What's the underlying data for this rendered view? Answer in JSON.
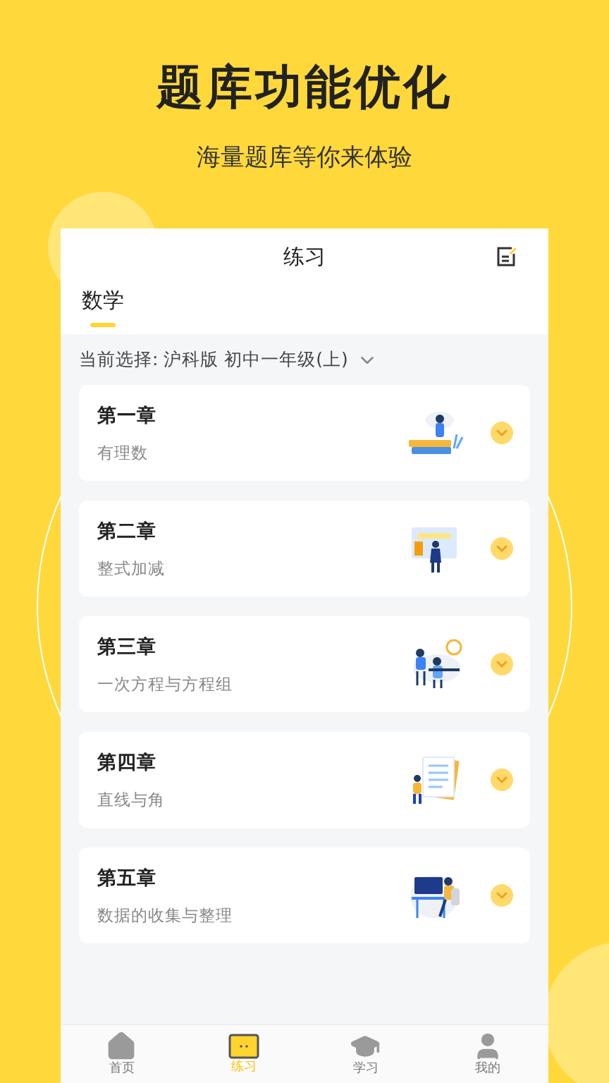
{
  "headline": "题库功能优化",
  "subtitle": "海量题库等你来体验",
  "screen": {
    "title": "练习",
    "subject_tabs": [
      {
        "label": "数学",
        "selected": true
      }
    ],
    "current_selection": "当前选择: 沪科版 初中一年级(上)",
    "chapters": [
      {
        "title": "第一章",
        "topic": "有理数"
      },
      {
        "title": "第二章",
        "topic": "整式加减"
      },
      {
        "title": "第三章",
        "topic": "一次方程与方程组"
      },
      {
        "title": "第四章",
        "topic": "直线与角"
      },
      {
        "title": "第五章",
        "topic": "数据的收集与整理"
      }
    ],
    "nav": [
      {
        "label": "首页",
        "selected": false
      },
      {
        "label": "练习",
        "selected": true
      },
      {
        "label": "学习",
        "selected": false
      },
      {
        "label": "我的",
        "selected": false
      }
    ]
  }
}
